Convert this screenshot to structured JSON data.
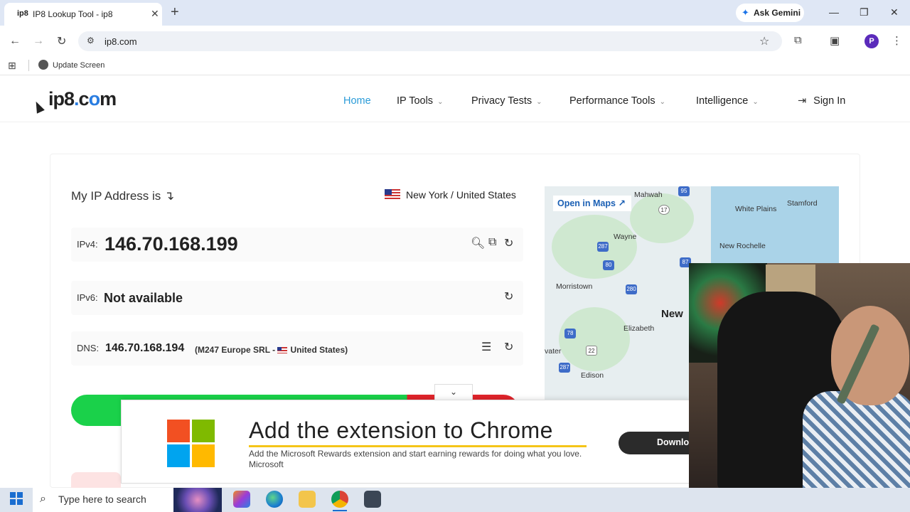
{
  "browser": {
    "tab_title": "IP8 Lookup Tool - ip8",
    "tab_favicon": "ip8",
    "ask_gemini": "Ask Gemini",
    "url": "ip8.com",
    "profile_initial": "P",
    "bookmark_label": "Update Screen"
  },
  "site": {
    "logo_main": "ip8",
    "logo_dot": ".",
    "logo_tail": "c",
    "logo_o": "o",
    "logo_end": "m",
    "nav": [
      {
        "label": "Home",
        "active": true
      },
      {
        "label": "IP Tools"
      },
      {
        "label": "Privacy Tests"
      },
      {
        "label": "Performance Tools"
      },
      {
        "label": "Intelligence"
      }
    ],
    "sign_in": "Sign In"
  },
  "ipinfo": {
    "heading": "My IP Address is",
    "heading_arrow": "↴",
    "location": "New York / United States",
    "ipv4_label": "IPv4:",
    "ipv4_value": "146.70.168.199",
    "ipv6_label": "IPv6:",
    "ipv6_value": "Not available",
    "dns_label": "DNS:",
    "dns_value": "146.70.168.194",
    "dns_provider_prefix": "(M247 Europe SRL - ",
    "dns_provider_country": "United States)"
  },
  "map": {
    "open_in_maps": "Open in Maps",
    "labels": [
      "Mahwah",
      "White Plains",
      "Stamford",
      "Wayne",
      "New Rochelle",
      "Morristown",
      "New",
      "Elizabeth",
      "vater",
      "Edison"
    ],
    "shields": [
      "17",
      "287",
      "80",
      "280",
      "78",
      "22",
      "287",
      "87",
      "95",
      "95"
    ]
  },
  "popup": {
    "title": "Add the extension to Chrome",
    "description": "Add the Microsoft Rewards extension and start earning rewards for doing what you love. Microsoft",
    "download_label": "Downlo"
  },
  "taskbar": {
    "search_placeholder": "Type here to search"
  },
  "colors": {
    "accent_nav": "#2a9bd8",
    "ms_red": "#f25022",
    "ms_green": "#7fba00",
    "ms_blue": "#00a4ef",
    "ms_yellow": "#ffb900"
  }
}
